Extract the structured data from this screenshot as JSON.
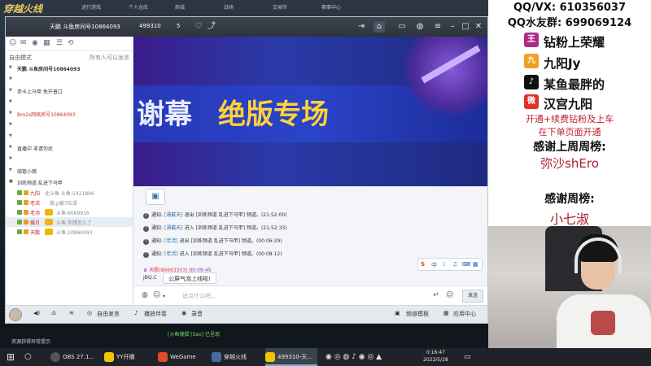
{
  "game": {
    "logo": "穿越火线",
    "tabs": [
      "进行游戏",
      "个人仓库",
      "商城",
      "战场",
      "交易所",
      "赛事中心"
    ],
    "bottom_line1": "资源获得异常提示",
    "bottom_line2": "[斗鱼搜狐 [Sao] 已呈现"
  },
  "yy": {
    "title": "天鹏 斗鱼房间号10864093",
    "channel_id": "499310",
    "online": "5",
    "left_sort": "自由模式",
    "left_all": "所有人可以发言",
    "channels": [
      {
        "name": "天鹏 斗鱼房间号10864093"
      },
      {
        "name": "赤卡上马甲 免开普口"
      },
      {
        "name": "Bro2s网络房号10864093"
      },
      {
        "name": ""
      },
      {
        "name": ""
      },
      {
        "name": "直播中 非请勿扰"
      },
      {
        "name": ""
      },
      {
        "name": "骑管小窝"
      },
      {
        "name": "训练频道 乱进下马甲"
      }
    ],
    "members": [
      {
        "name": "九阳",
        "extra": "北斗鱼 斗鱼:5421896"
      },
      {
        "name": "老活",
        "extra": "我:p被7拉活"
      },
      {
        "name": "老汤",
        "extra": "斗鱼:6069916"
      },
      {
        "name": "骚贝",
        "extra": "斗鱼 你想怎么了"
      },
      {
        "name": "天鹏",
        "extra": "斗鱼:10864093"
      }
    ],
    "messages": [
      {
        "prefix": "通知:",
        "who": "[涌戴天]",
        "text": "退出 [训练频道 乱进下马甲] 频道。(21:52:00)"
      },
      {
        "prefix": "通知:",
        "who": "[涌戴天]",
        "text": "进入 [训练频道 乱进下马甲] 频道。(21:52:33)"
      },
      {
        "prefix": "通知:",
        "who": "[老活]",
        "text": "退出 [训练频道 乱进下马甲] 频道。(00:06:29)"
      },
      {
        "prefix": "通知:",
        "who": "[老活]",
        "text": "进入 [训练频道 乱进下马甲] 频道。(00:08:12)"
      }
    ],
    "sys_msg_name": "天鹏(86663303)",
    "sys_msg_time": "00:09:45",
    "jbq": "JBQ.C",
    "tooltip": "公屏气泡上线啦!",
    "input_placeholder": "说点什么吧...",
    "send_label": "发送",
    "bottom": {
      "free_speak": "自由发言",
      "play_accompany": "播放伴奏",
      "record": "录音",
      "template": "频道模板",
      "app_center": "应用中心"
    },
    "ime_label": "中"
  },
  "overlay": {
    "qq": "QQ/VX: 610356037",
    "qq_friends": "QQ水友群: 699069124",
    "socials": [
      {
        "icon": "王",
        "text": "钻粉上荣耀",
        "color": "#b02a8a"
      },
      {
        "icon": "九",
        "text": "九阳Jy",
        "color": "#f0a020"
      },
      {
        "icon": "♪",
        "text": "某鱼最胖的",
        "color": "#111111"
      },
      {
        "icon": "微",
        "text": "汉宫九阳",
        "color": "#e0322a"
      }
    ],
    "note1": "开通+续费钻粉及上车",
    "note2": "在下单页面开通",
    "thanks_week_top": "感谢上周周榜:",
    "thanks_week_top_name": "弥沙shEro",
    "thanks_week": "感谢周榜:",
    "thanks_week_name": "小七淑"
  },
  "taskbar": {
    "items": [
      "OBS 27.1...",
      "YY开播",
      "WeGame",
      "穿越火线",
      "499310-天..."
    ],
    "time": "0:16:47",
    "date": "2022/5/28"
  }
}
